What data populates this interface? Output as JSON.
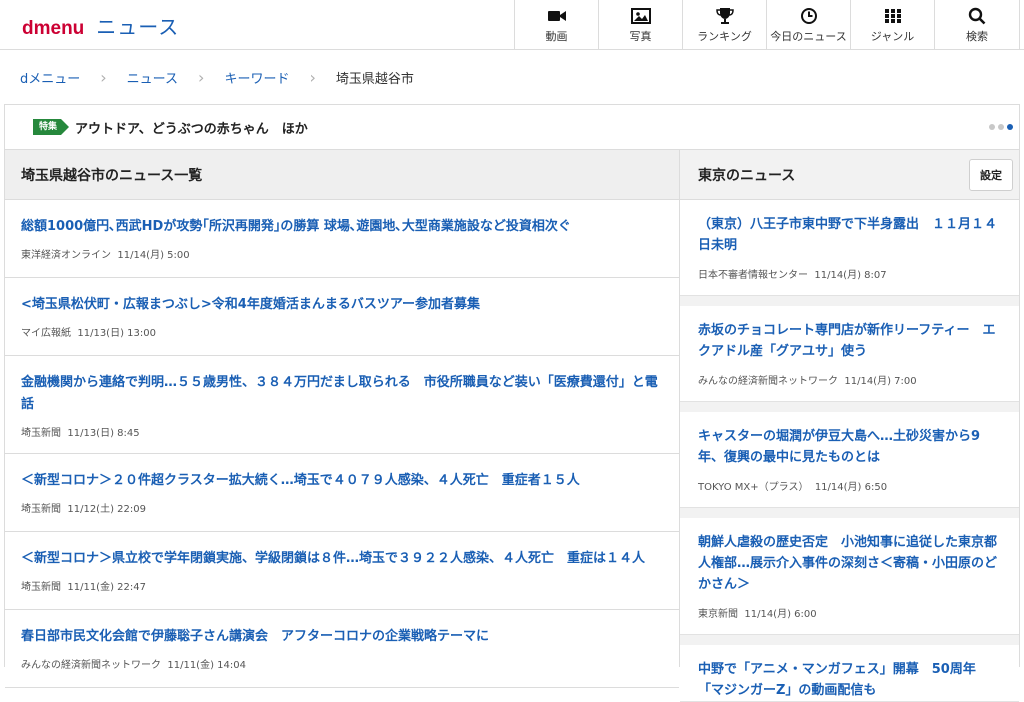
{
  "brand": {
    "d": "d",
    "menu": "menu",
    "section": "ニュース"
  },
  "nav": [
    {
      "label": "動画",
      "icon": "video-camera-icon"
    },
    {
      "label": "写真",
      "icon": "photo-icon"
    },
    {
      "label": "ランキング",
      "icon": "trophy-icon"
    },
    {
      "label": "今日のニュース",
      "icon": "clock-icon"
    },
    {
      "label": "ジャンル",
      "icon": "grid-icon"
    },
    {
      "label": "検索",
      "icon": "search-icon"
    }
  ],
  "breadcrumb": [
    "dメニュー",
    "ニュース",
    "キーワード",
    "埼玉県越谷市"
  ],
  "feature": {
    "badge": "特集",
    "text": "アウトドア、どうぶつの赤ちゃん　ほか"
  },
  "left": {
    "heading": "埼玉県越谷市のニュース一覧",
    "items": [
      {
        "title": "総額1000億円､西武HDが攻勢｢所沢再開発｣の勝算 球場､遊園地､大型商業施設など投資相次ぐ",
        "source": "東洋経済オンライン",
        "date": "11/14(月) 5:00"
      },
      {
        "title": "<埼玉県松伏町・広報まつぶし>令和4年度婚活まんまるバスツアー参加者募集",
        "source": "マイ広報紙",
        "date": "11/13(日) 13:00"
      },
      {
        "title": "金融機関から連絡で判明…５５歳男性、３８４万円だまし取られる　市役所職員など装い「医療費還付」と電話",
        "source": "埼玉新聞",
        "date": "11/13(日) 8:45"
      },
      {
        "title": "＜新型コロナ＞２０件超クラスター拡大続く…埼玉で４０７９人感染、４人死亡　重症者１５人",
        "source": "埼玉新聞",
        "date": "11/12(土) 22:09"
      },
      {
        "title": "＜新型コロナ＞県立校で学年閉鎖実施、学級閉鎖は８件…埼玉で３９２２人感染、４人死亡　重症は１４人",
        "source": "埼玉新聞",
        "date": "11/11(金) 22:47"
      },
      {
        "title": "春日部市民文化会館で伊藤聡子さん講演会　アフターコロナの企業戦略テーマに",
        "source": "みんなの経済新聞ネットワーク",
        "date": "11/11(金) 14:04"
      }
    ]
  },
  "right": {
    "heading": "東京のニュース",
    "settings_label": "設定",
    "items": [
      {
        "title": "（東京）八王子市東中野で下半身露出　１１月１４日未明",
        "source": "日本不審者情報センター",
        "date": "11/14(月) 8:07"
      },
      {
        "title": "赤坂のチョコレート専門店が新作リーフティー　エクアドル産「グアユサ」使う",
        "source": "みんなの経済新聞ネットワーク",
        "date": "11/14(月) 7:00"
      },
      {
        "title": "キャスターの堀潤が伊豆大島へ…土砂災害から9年、復興の最中に見たものとは",
        "source": "TOKYO MX+（プラス）",
        "date": "11/14(月) 6:50"
      },
      {
        "title": "朝鮮人虐殺の歴史否定　小池知事に追従した東京都人権部…展示介入事件の深刻さ＜寄稿・小田原のどかさん＞",
        "source": "東京新聞",
        "date": "11/14(月) 6:00"
      },
      {
        "title": "中野で「アニメ・マンガフェス」開幕　50周年「マジンガーZ」の動画配信も",
        "source": "",
        "date": ""
      }
    ]
  },
  "colors": {
    "brand_red": "#cc0033",
    "link_blue": "#1a5fb4",
    "feature_green": "#26883c"
  }
}
